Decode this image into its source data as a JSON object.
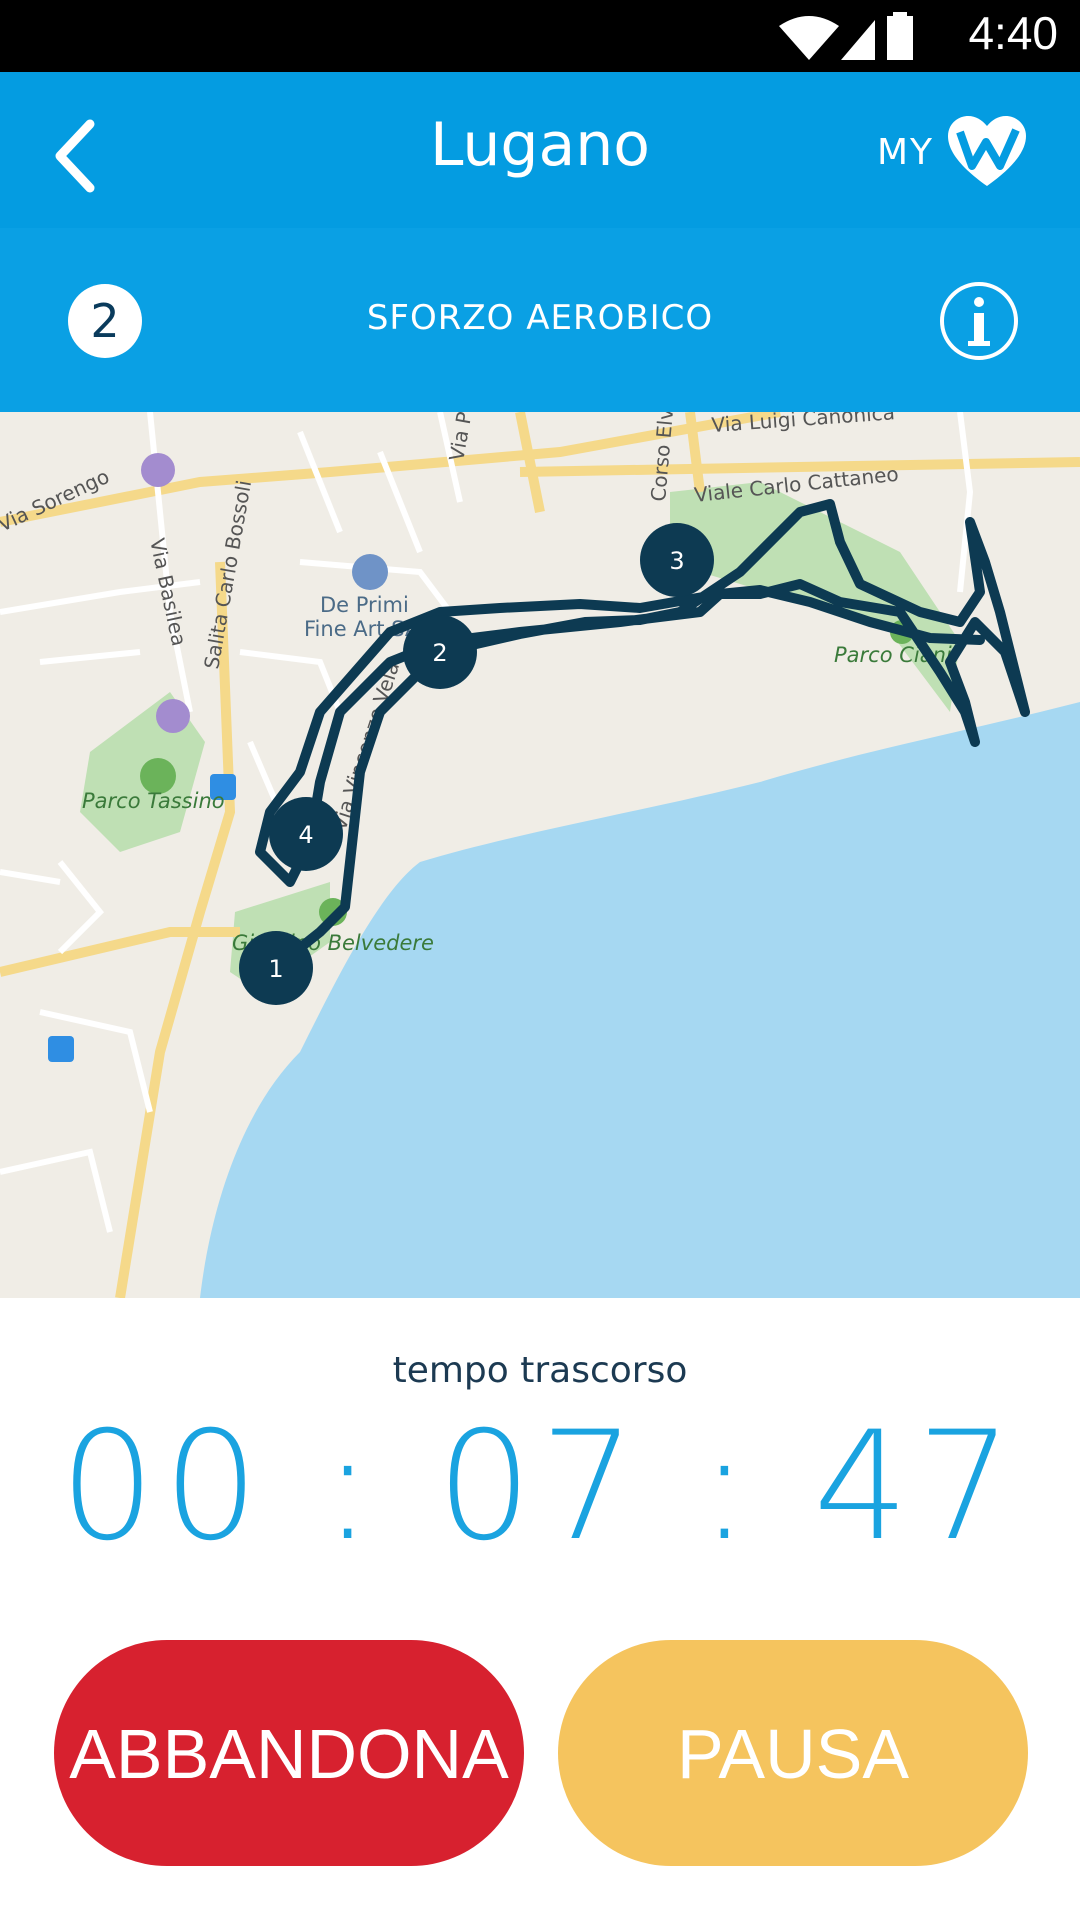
{
  "status_bar": {
    "time": "4:40"
  },
  "header": {
    "title": "Lugano",
    "my_label": "MY",
    "level": "2",
    "subtitle": "SFORZO AEROBICO"
  },
  "map": {
    "labels": {
      "viale": "Viale Carlo Cattaneo",
      "via_basilea": "Via Basilea",
      "salita": "Salita Carlo Bossoli",
      "de_primi_1": "De Primi",
      "de_primi_2": "Fine Art SA",
      "parco_tassino": "Parco Tassino",
      "parco_ciani": "Parco Ciani",
      "belvedere": "Giardino Belvedere",
      "vincenzo_vela": "Via Vincenzo Vela",
      "sorengo": "Via Sorengo",
      "corso": "Corso Elvezia",
      "via_pr": "Via Pretorio",
      "luigi": "Via Luigi Canonica"
    },
    "markers": [
      "1",
      "2",
      "3",
      "4"
    ]
  },
  "timer": {
    "label": "tempo trascorso",
    "value": "00 : 07 : 47"
  },
  "buttons": {
    "abandon": "ABBANDONA",
    "pause": "PAUSA"
  },
  "colors": {
    "header": "#049ce1",
    "route": "#0d3a52",
    "abandon": "#d7212f",
    "pause": "#f5c45e",
    "timer": "#1aa3e0"
  }
}
